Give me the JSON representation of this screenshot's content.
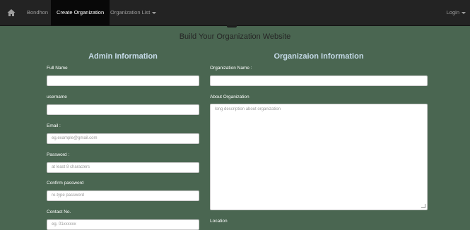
{
  "nav": {
    "brand": "Bondhon",
    "create_org": "Create Organization",
    "org_list": "Organization List",
    "login": "Login"
  },
  "page": {
    "title": "Build Your Organization Website"
  },
  "admin": {
    "title": "Admin Information",
    "full_name_label": "Full Name",
    "username_label": "username",
    "email_label": "Email :",
    "email_placeholder": "eg.example@gmail.com",
    "password_label": "Password :",
    "password_placeholder": "at least 8 characters",
    "confirm_label": "Confirm password",
    "confirm_placeholder": "re-type password",
    "contact_label": "Contact No.",
    "contact_placeholder": "eg. 01xxxxxx"
  },
  "org": {
    "title": "Organizaion Information",
    "name_label": "Organization Name :",
    "about_label": "About Organization",
    "about_placeholder": "long description about organization",
    "location_label": "Location"
  },
  "icons": {
    "home": "home-icon"
  }
}
